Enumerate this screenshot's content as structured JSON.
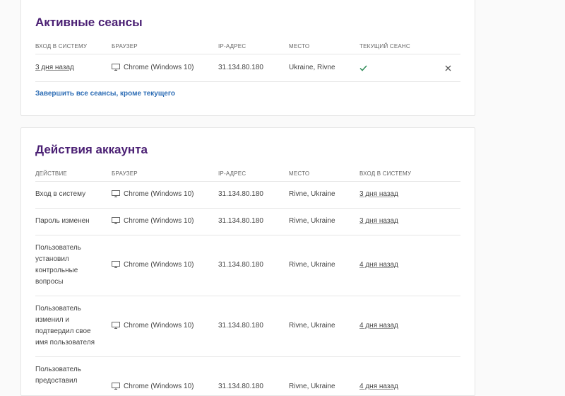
{
  "sessions": {
    "title": "Активные сеансы",
    "headers": [
      "ВХОД В СИСТЕМУ",
      "БРАУЗЕР",
      "IP-АДРЕС",
      "МЕСТО",
      "ТЕКУЩИЙ СЕАНС"
    ],
    "rows": [
      {
        "login": "3 дня назад",
        "browser": "Chrome (Windows 10)",
        "ip": "31.134.80.180",
        "place": "Ukraine, Rivne"
      }
    ],
    "terminate_label": "Завершить все сеансы, кроме текущего",
    "colors": {
      "title": "#4a1f73",
      "link": "#2d6db5",
      "check": "#2e8b57"
    }
  },
  "actions": {
    "title": "Действия аккаунта",
    "headers": [
      "ДЕЙСТВИЕ",
      "БРАУЗЕР",
      "IP-АДРЕС",
      "МЕСТО",
      "ВХОД В СИСТЕМУ"
    ],
    "rows": [
      {
        "action": "Вход в систему",
        "browser": "Chrome (Windows 10)",
        "ip": "31.134.80.180",
        "place": "Rivne, Ukraine",
        "login": "3 дня назад"
      },
      {
        "action": "Пароль изменен",
        "browser": "Chrome (Windows 10)",
        "ip": "31.134.80.180",
        "place": "Rivne, Ukraine",
        "login": "3 дня назад"
      },
      {
        "action": "Пользователь установил контрольные вопросы",
        "browser": "Chrome (Windows 10)",
        "ip": "31.134.80.180",
        "place": "Rivne, Ukraine",
        "login": "4 дня назад"
      },
      {
        "action": "Пользователь изменил и подтвердил свое имя пользователя",
        "browser": "Chrome (Windows 10)",
        "ip": "31.134.80.180",
        "place": "Rivne, Ukraine",
        "login": "4 дня назад"
      },
      {
        "action": "Пользователь предоставил",
        "browser": "Chrome (Windows 10)",
        "ip": "31.134.80.180",
        "place": "Rivne, Ukraine",
        "login": "4 дня назад"
      }
    ]
  }
}
